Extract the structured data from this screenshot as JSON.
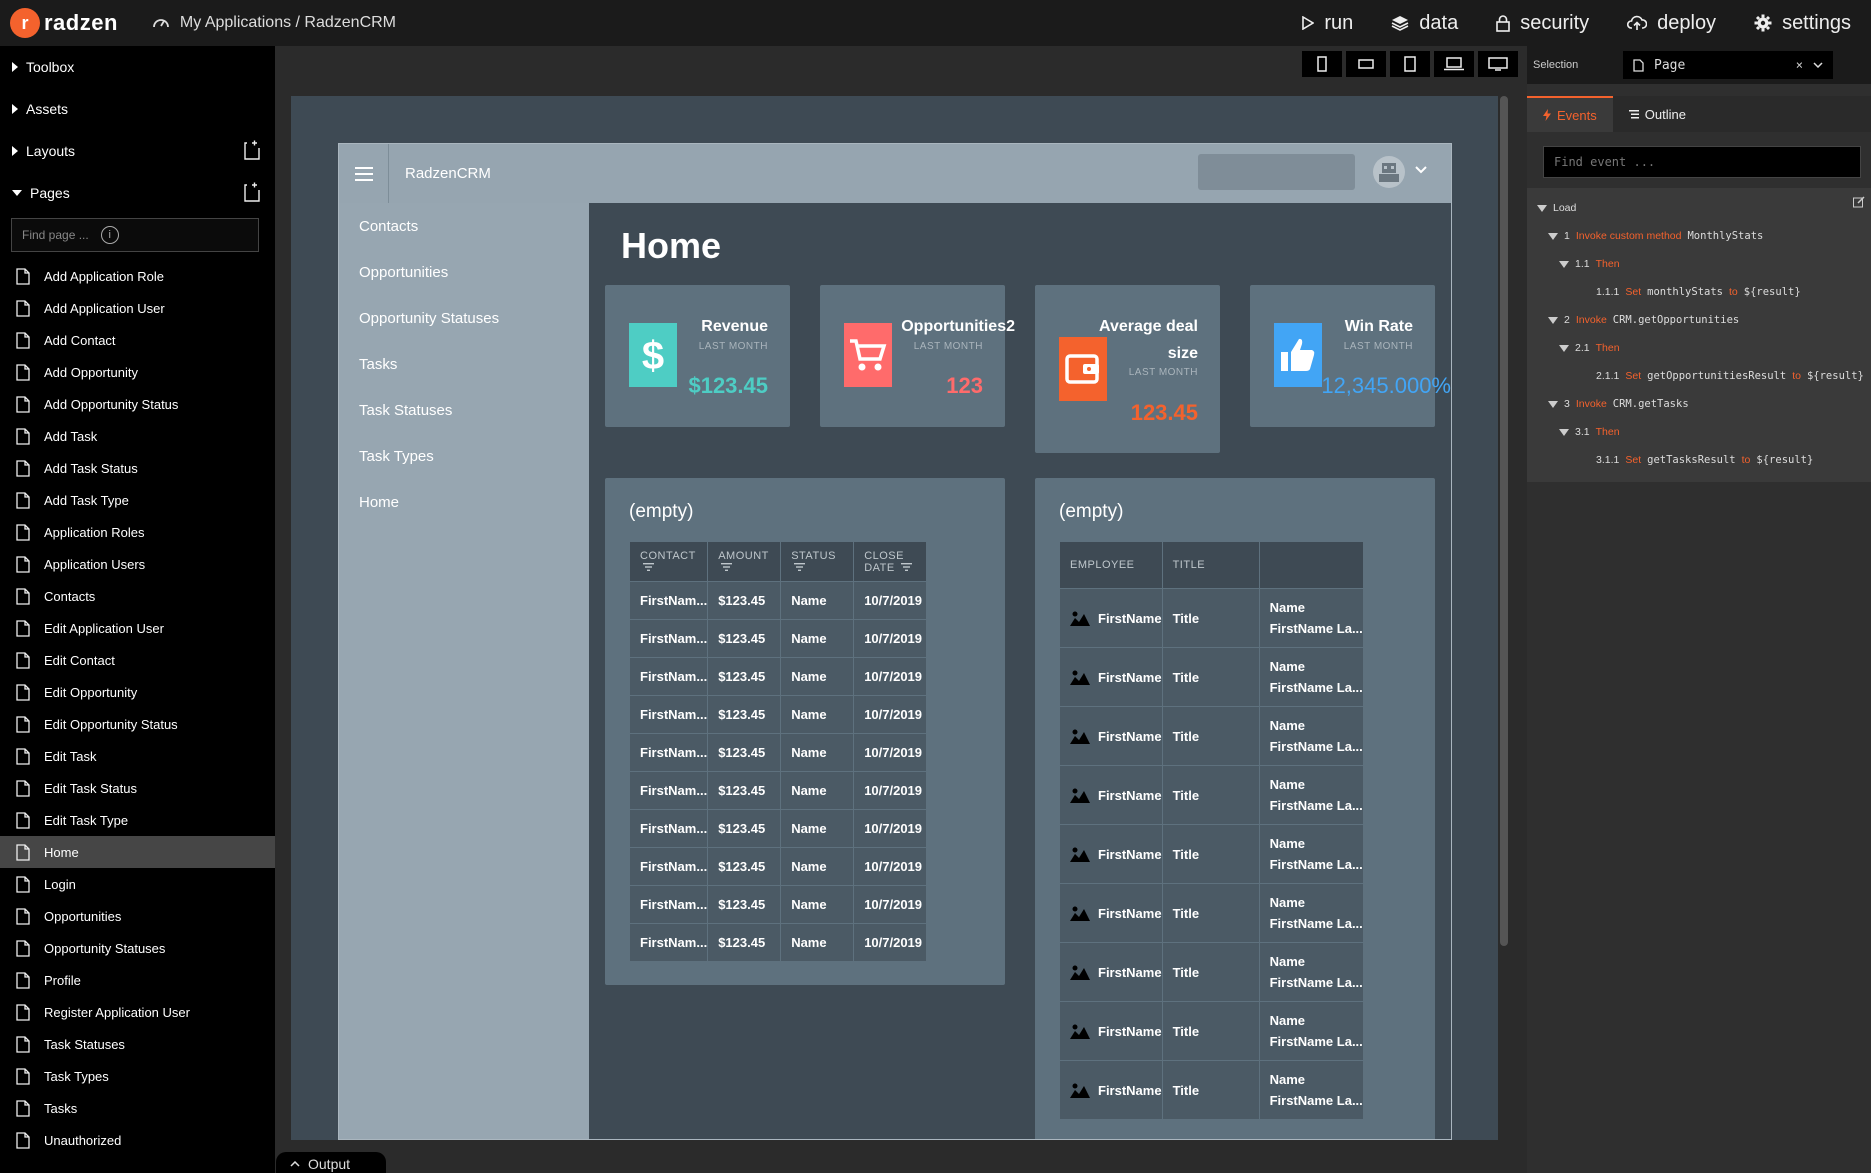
{
  "topbar": {
    "logo_letter": "r",
    "logo_text": "radzen",
    "breadcrumb": "My Applications / RadzenCRM",
    "nav": [
      {
        "label": "run",
        "icon": "play-icon"
      },
      {
        "label": "data",
        "icon": "layers-icon"
      },
      {
        "label": "security",
        "icon": "lock-icon"
      },
      {
        "label": "deploy",
        "icon": "cloud-upload-icon"
      },
      {
        "label": "settings",
        "icon": "gear-icon"
      }
    ]
  },
  "sidebar": {
    "sections": [
      "Toolbox",
      "Assets",
      "Layouts",
      "Pages"
    ],
    "find_placeholder": "Find page ...",
    "info_symbol": "i",
    "pages": [
      "Add Application Role",
      "Add Application User",
      "Add Contact",
      "Add Opportunity",
      "Add Opportunity Status",
      "Add Task",
      "Add Task Status",
      "Add Task Type",
      "Application Roles",
      "Application Users",
      "Contacts",
      "Edit Application User",
      "Edit Contact",
      "Edit Opportunity",
      "Edit Opportunity Status",
      "Edit Task",
      "Edit Task Status",
      "Edit Task Type",
      "Home",
      "Login",
      "Opportunities",
      "Opportunity Statuses",
      "Profile",
      "Register Application User",
      "Task Statuses",
      "Task Types",
      "Tasks",
      "Unauthorized"
    ],
    "active_page": "Home"
  },
  "app": {
    "title": "RadzenCRM",
    "nav": [
      "Contacts",
      "Opportunities",
      "Opportunity Statuses",
      "Tasks",
      "Task Statuses",
      "Task Types",
      "Home"
    ],
    "page_title": "Home",
    "stats": [
      {
        "label": "Revenue",
        "sub": "LAST MONTH",
        "value": "$123.45",
        "color": "#4ecdc4",
        "icon": "dollar-icon"
      },
      {
        "label": "Opportunities2",
        "sub": "LAST MONTH",
        "value": "123",
        "color": "#ff6b6b",
        "icon": "cart-icon"
      },
      {
        "label": "Average deal size",
        "sub": "LAST MONTH",
        "value": "123.45",
        "color": "#f4622d",
        "icon": "wallet-icon"
      },
      {
        "label": "Win Rate",
        "sub": "LAST MONTH",
        "value": "12,345.000%",
        "color": "#42a5f5",
        "icon": "thumbs-up-icon"
      }
    ],
    "panel1": {
      "title": "(empty)",
      "columns": [
        "CONTACT",
        "AMOUNT",
        "STATUS",
        "CLOSE DATE"
      ],
      "rows": [
        [
          "FirstNam...",
          "$123.45",
          "Name",
          "10/7/2019"
        ],
        [
          "FirstNam...",
          "$123.45",
          "Name",
          "10/7/2019"
        ],
        [
          "FirstNam...",
          "$123.45",
          "Name",
          "10/7/2019"
        ],
        [
          "FirstNam...",
          "$123.45",
          "Name",
          "10/7/2019"
        ],
        [
          "FirstNam...",
          "$123.45",
          "Name",
          "10/7/2019"
        ],
        [
          "FirstNam...",
          "$123.45",
          "Name",
          "10/7/2019"
        ],
        [
          "FirstNam...",
          "$123.45",
          "Name",
          "10/7/2019"
        ],
        [
          "FirstNam...",
          "$123.45",
          "Name",
          "10/7/2019"
        ],
        [
          "FirstNam...",
          "$123.45",
          "Name",
          "10/7/2019"
        ],
        [
          "FirstNam...",
          "$123.45",
          "Name",
          "10/7/2019"
        ]
      ]
    },
    "panel2": {
      "title": "(empty)",
      "columns": [
        "EMPLOYEE",
        "TITLE",
        ""
      ],
      "rows": [
        [
          "FirstName",
          "Title",
          "Name",
          "FirstName La..."
        ],
        [
          "FirstName",
          "Title",
          "Name",
          "FirstName La..."
        ],
        [
          "FirstName",
          "Title",
          "Name",
          "FirstName La..."
        ],
        [
          "FirstName",
          "Title",
          "Name",
          "FirstName La..."
        ],
        [
          "FirstName",
          "Title",
          "Name",
          "FirstName La..."
        ],
        [
          "FirstName",
          "Title",
          "Name",
          "FirstName La..."
        ],
        [
          "FirstName",
          "Title",
          "Name",
          "FirstName La..."
        ],
        [
          "FirstName",
          "Title",
          "Name",
          "FirstName La..."
        ],
        [
          "FirstName",
          "Title",
          "Name",
          "FirstName La..."
        ]
      ]
    }
  },
  "rpanel": {
    "selection_label": "Selection",
    "selection_value": "Page",
    "clear_symbol": "×",
    "tabs": [
      "Events",
      "Outline"
    ],
    "find_placeholder": "Find event ...",
    "events": [
      {
        "num": "",
        "kind": "",
        "text": "Load",
        "depth": 0
      },
      {
        "num": "1",
        "kind": "Invoke custom method",
        "text": "MonthlyStats",
        "depth": 1
      },
      {
        "num": "1.1",
        "kind": "Then",
        "text": "",
        "depth": 2
      },
      {
        "num": "1.1.1",
        "kind": "Set",
        "text": "monthlyStats",
        "to": "${result}",
        "depth": 3
      },
      {
        "num": "2",
        "kind": "Invoke",
        "text": "CRM.getOpportunities",
        "depth": 1
      },
      {
        "num": "2.1",
        "kind": "Then",
        "text": "",
        "depth": 2
      },
      {
        "num": "2.1.1",
        "kind": "Set",
        "text": "getOpportunitiesResult",
        "to": "${result}",
        "depth": 3
      },
      {
        "num": "3",
        "kind": "Invoke",
        "text": "CRM.getTasks",
        "depth": 1
      },
      {
        "num": "3.1",
        "kind": "Then",
        "text": "",
        "depth": 2
      },
      {
        "num": "3.1.1",
        "kind": "Set",
        "text": "getTasksResult",
        "to": "${result}",
        "depth": 3
      }
    ],
    "to_word": "to"
  },
  "output_label": "Output"
}
